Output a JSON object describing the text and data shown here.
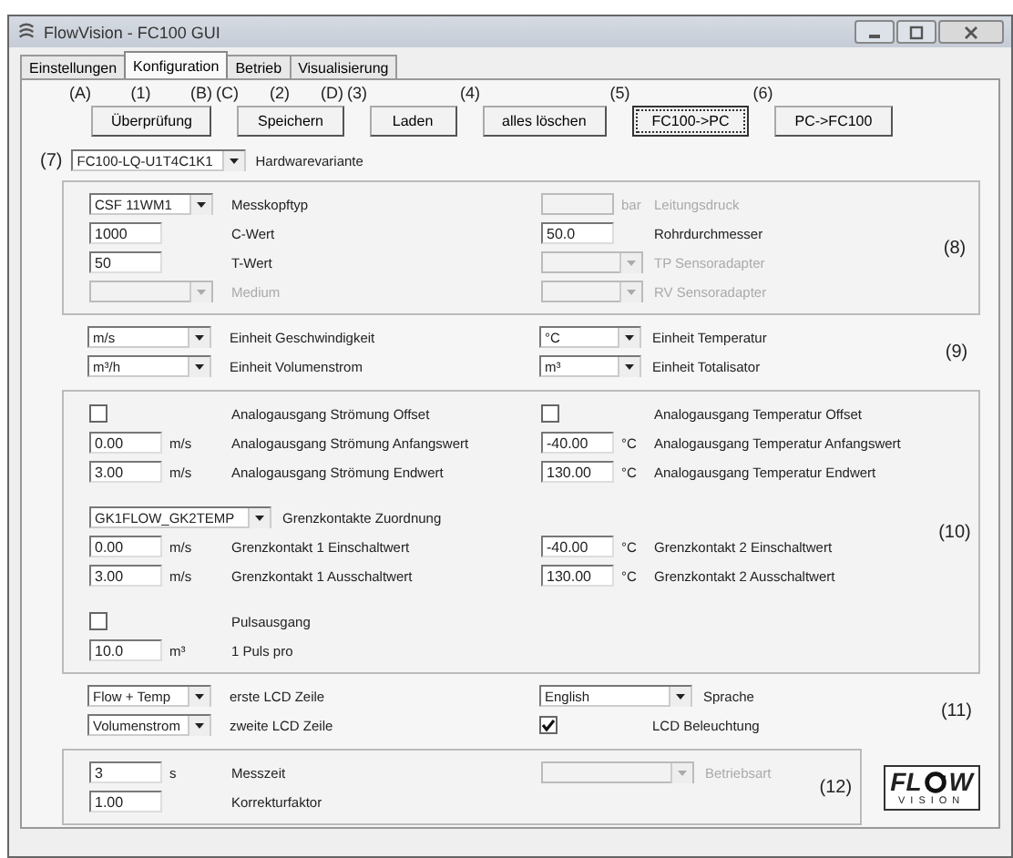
{
  "window": {
    "title": "FlowVision - FC100 GUI"
  },
  "tabs": [
    {
      "label": "Einstellungen",
      "selected": false
    },
    {
      "label": "Konfiguration",
      "selected": true
    },
    {
      "label": "Betrieb",
      "selected": false
    },
    {
      "label": "Visualisierung",
      "selected": false
    }
  ],
  "toolbar": [
    {
      "markers": [
        "(A)",
        "(1)",
        "(B)"
      ],
      "label": "Überprüfung",
      "focused": false
    },
    {
      "markers": [
        "(C)",
        "(2)",
        "(D)"
      ],
      "label": "Speichern",
      "focused": false
    },
    {
      "markers": [
        "(3)"
      ],
      "label": "Laden",
      "focused": false
    },
    {
      "markers": [
        "(4)"
      ],
      "label": "alles löschen",
      "focused": false
    },
    {
      "markers": [
        "(5)"
      ],
      "label": "FC100->PC",
      "focused": true
    },
    {
      "markers": [
        "(6)"
      ],
      "label": "PC->FC100",
      "focused": false
    }
  ],
  "hardware": {
    "marker": "(7)",
    "value": "FC100-LQ-U1T4C1K1",
    "caption": "Hardwarevariante"
  },
  "sections": [
    {
      "kind": "boxed",
      "marker": "(8)",
      "groups": [
        [
          {
            "cells": [
              {
                "kind": "select",
                "value": "CSF 11WM1",
                "caption": "Messkopftyp",
                "disabled": false
              },
              {
                "kind": "input",
                "unit": "bar",
                "caption": "Leitungsdruck",
                "disabled": true
              }
            ]
          },
          {
            "cells": [
              {
                "kind": "input",
                "value": "1000",
                "caption": "C-Wert",
                "disabled": false
              },
              {
                "kind": "input",
                "value": "50.0",
                "caption": "Rohrdurchmesser",
                "disabled": false
              }
            ]
          },
          {
            "cells": [
              {
                "kind": "input",
                "value": "50",
                "caption": "T-Wert",
                "disabled": false
              },
              {
                "kind": "select",
                "caption": "TP Sensoradapter",
                "disabled": true
              }
            ]
          },
          {
            "cells": [
              {
                "kind": "select",
                "caption": "Medium",
                "disabled": true
              },
              {
                "kind": "select",
                "caption": "RV Sensoradapter",
                "disabled": true
              }
            ]
          }
        ]
      ]
    },
    {
      "kind": "plain",
      "marker": "(9)",
      "groups": [
        [
          {
            "cells": [
              {
                "kind": "select",
                "value": "m/s",
                "caption": "Einheit Geschwindigkeit",
                "disabled": false
              },
              {
                "kind": "select",
                "value": "°C",
                "caption": "Einheit Temperatur",
                "disabled": false
              }
            ]
          },
          {
            "cells": [
              {
                "kind": "select",
                "value": "m³/h",
                "caption": "Einheit Volumenstrom",
                "disabled": false
              },
              {
                "kind": "select",
                "value": "m³",
                "caption": "Einheit Totalisator",
                "disabled": false
              }
            ]
          }
        ]
      ]
    },
    {
      "kind": "boxed",
      "marker": "(10)",
      "groups": [
        [
          {
            "cells": [
              {
                "kind": "checkbox",
                "checked": false,
                "caption": "Analogausgang Strömung Offset"
              },
              {
                "kind": "checkbox",
                "checked": false,
                "caption": "Analogausgang Temperatur Offset"
              }
            ]
          },
          {
            "cells": [
              {
                "kind": "input",
                "value": "0.00",
                "unit": "m/s",
                "caption": "Analogausgang Strömung Anfangswert",
                "disabled": false
              },
              {
                "kind": "input",
                "value": "-40.00",
                "unit": "°C",
                "caption": "Analogausgang Temperatur Anfangswert",
                "disabled": false
              }
            ]
          },
          {
            "cells": [
              {
                "kind": "input",
                "value": "3.00",
                "unit": "m/s",
                "caption": "Analogausgang Strömung Endwert",
                "disabled": false
              },
              {
                "kind": "input",
                "value": "130.00",
                "unit": "°C",
                "caption": "Analogausgang Temperatur Endwert",
                "disabled": false
              }
            ]
          }
        ],
        [
          {
            "cells": [
              {
                "kind": "wide-select",
                "value": "GK1FLOW_GK2TEMP",
                "caption": "Grenzkontakte Zuordnung",
                "disabled": false
              }
            ]
          },
          {
            "cells": [
              {
                "kind": "input",
                "value": "0.00",
                "unit": "m/s",
                "caption": "Grenzkontakt 1 Einschaltwert",
                "disabled": false
              },
              {
                "kind": "input",
                "value": "-40.00",
                "unit": "°C",
                "caption": "Grenzkontakt 2 Einschaltwert",
                "disabled": false
              }
            ]
          },
          {
            "cells": [
              {
                "kind": "input",
                "value": "3.00",
                "unit": "m/s",
                "caption": "Grenzkontakt 1 Ausschaltwert",
                "disabled": false
              },
              {
                "kind": "input",
                "value": "130.00",
                "unit": "°C",
                "caption": "Grenzkontakt 2 Ausschaltwert",
                "disabled": false
              }
            ]
          }
        ],
        [
          {
            "cells": [
              {
                "kind": "checkbox",
                "checked": false,
                "caption": "Pulsausgang"
              }
            ]
          },
          {
            "cells": [
              {
                "kind": "input",
                "value": "10.0",
                "unit": "m³",
                "caption": "1 Puls pro",
                "disabled": false
              }
            ]
          }
        ]
      ]
    },
    {
      "kind": "plain",
      "marker": "(11)",
      "groups": [
        [
          {
            "cells": [
              {
                "kind": "select",
                "value": "Flow + Temp",
                "caption": "erste LCD Zeile",
                "disabled": false
              },
              {
                "kind": "long-select",
                "value": "English",
                "caption": "Sprache",
                "disabled": false
              }
            ]
          },
          {
            "cells": [
              {
                "kind": "select",
                "value": "Volumenstrom",
                "caption": "zweite LCD Zeile",
                "disabled": false
              },
              {
                "kind": "checkbox",
                "checked": true,
                "caption": "LCD Beleuchtung"
              }
            ]
          }
        ]
      ]
    },
    {
      "kind": "boxed",
      "marker": "(12)",
      "logo": {
        "left": "FL",
        "right": "W",
        "tagline": "VISION"
      },
      "groups": [
        [
          {
            "cells": [
              {
                "kind": "input",
                "value": "3",
                "unit": "s",
                "caption": "Messzeit",
                "disabled": false
              },
              {
                "kind": "long-select",
                "caption": "Betriebsart",
                "disabled": true
              }
            ]
          },
          {
            "cells": [
              {
                "kind": "input",
                "value": "1.00",
                "caption": "Korrekturfaktor",
                "disabled": false
              }
            ]
          }
        ]
      ]
    }
  ]
}
